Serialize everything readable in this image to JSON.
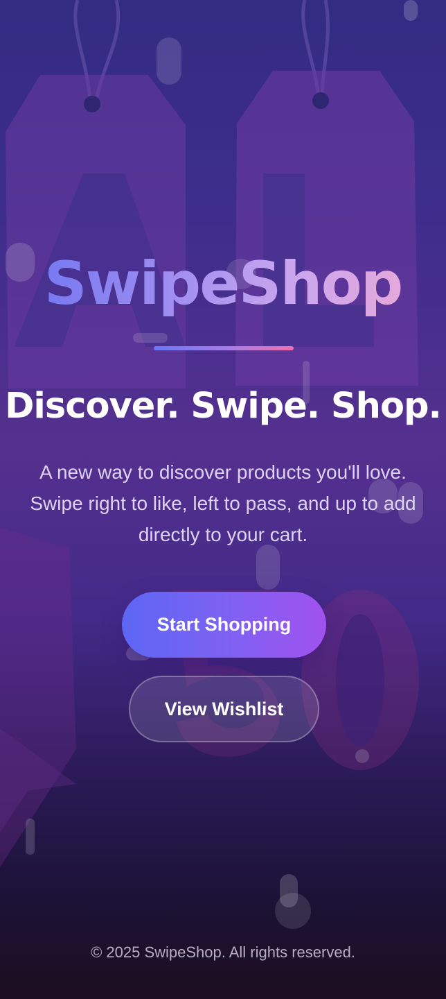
{
  "brand": {
    "name": "SwipeShop"
  },
  "hero": {
    "headline": "Discover. Swipe. Shop.",
    "tagline": "A new way to discover products you'll love. Swipe right to like, left to pass, and up to add directly to your cart."
  },
  "actions": {
    "primary_label": "Start Shopping",
    "secondary_label": "View Wishlist"
  },
  "footer": {
    "copyright": "© 2025 SwipeShop. All rights reserved."
  },
  "colors": {
    "background_top": "#332c82",
    "background_bottom": "#1c0e1f",
    "brand_gradient_start": "#6a72f2",
    "brand_gradient_end": "#f0a9d4",
    "primary_button_start": "#5d66f4",
    "primary_button_end": "#a052ef",
    "underline_end": "#f06fb0"
  },
  "background": {
    "image": "sale-price-tags"
  }
}
